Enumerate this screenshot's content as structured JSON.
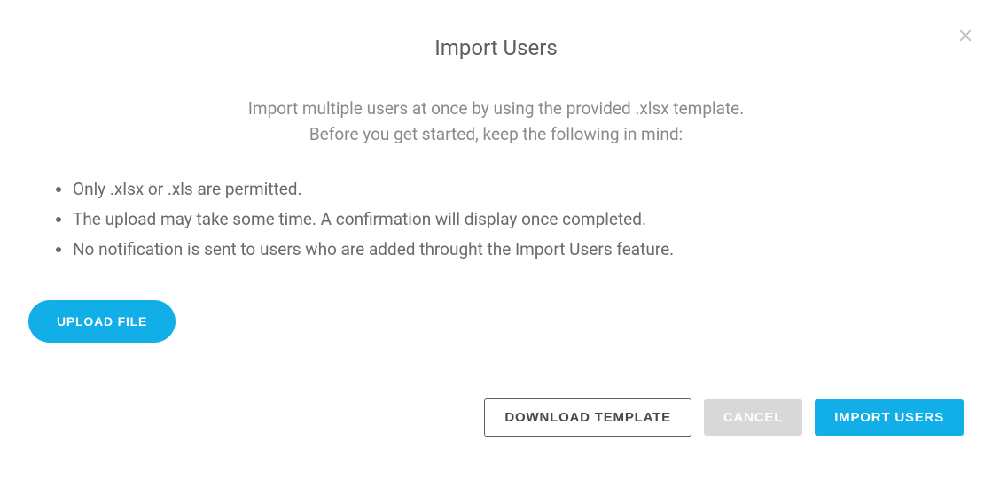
{
  "modal": {
    "title": "Import Users",
    "intro_line1": "Import multiple users at once by using the provided .xlsx template.",
    "intro_line2": "Before you get started, keep the following in mind:",
    "bullets": [
      "Only .xlsx or .xls are permitted.",
      "The upload may take some time. A confirmation will display once completed.",
      "No notification is sent to users who are added throught the Import Users feature."
    ],
    "upload_label": "UPLOAD FILE",
    "footer": {
      "download_template_label": "DOWNLOAD TEMPLATE",
      "cancel_label": "CANCEL",
      "import_label": "IMPORT USERS"
    }
  }
}
